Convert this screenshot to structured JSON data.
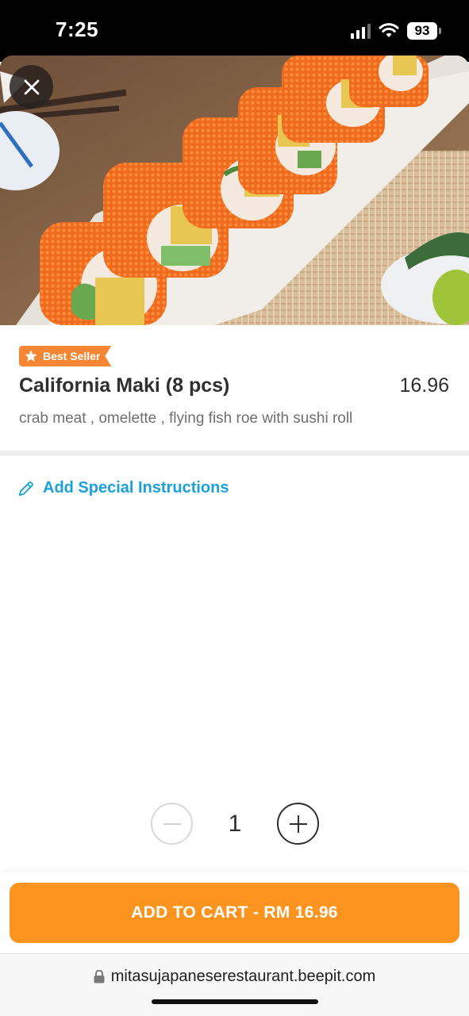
{
  "status_bar": {
    "time": "7:25",
    "battery": "93"
  },
  "product": {
    "badge": "Best Seller",
    "name": "California Maki (8 pcs)",
    "price": "16.96",
    "description": "crab meat , omelette , flying fish roe with sushi roll"
  },
  "special_instructions": {
    "label": "Add Special Instructions"
  },
  "quantity": {
    "value": "1"
  },
  "cart": {
    "button_label": "ADD TO CART - RM 16.96"
  },
  "browser": {
    "url": "mitasujapaneserestaurant.beepit.com"
  },
  "colors": {
    "accent_orange": "#fc941f",
    "badge_orange": "#f58634",
    "link_blue": "#1aa1dc"
  }
}
